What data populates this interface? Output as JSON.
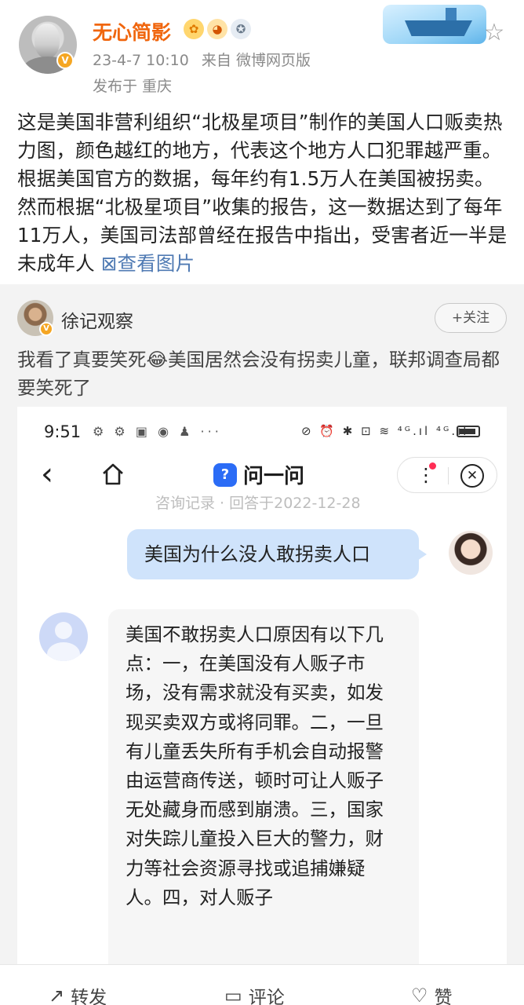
{
  "post": {
    "author": "无心简影",
    "time": "23-4-7 10:10",
    "source": "来自 微博网页版",
    "location": "发布于 重庆",
    "text": "这是美国非营利组织“北极星项目”制作的美国人口贩卖热力图，颜色越红的地方，代表这个地方人口犯罪越严重。根据美国官方的数据，每年约有1.5万人在美国被拐卖。然而根据“北极星项目”收集的报告，这一数据达到了每年11万人，美国司法部曾经在报告中指出，受害者近一半是未成年人 ",
    "view_image": "⊠查看图片",
    "verified_badge": "V"
  },
  "retweet": {
    "author": "徐记观察",
    "follow_label": "+关注",
    "text": "我看了真要笑死😂美国居然会没有拐卖儿童，联邦调查局都要笑死了",
    "verified_badge": "V"
  },
  "screenshot": {
    "status_time": "9:51",
    "status_icons_left": "⚙ ⚙ ▣ ◉ ♟ ···",
    "status_icons_right": "⊘ ⏰ ✱ ⊡ ≋ ⁴ᴳ.ıl ⁴ᴳ.ıl",
    "app_name": "问一问",
    "app_logo": "?",
    "record_line": "咨询记录 · 回答于2022-12-28",
    "question": "美国为什么没人敢拐卖人口",
    "answer": "美国不敢拐卖人口原因有以下几点：一，在美国没有人贩子市场，没有需求就没有买卖，如发现买卖双方或将同罪。二，一旦有儿童丢失所有手机会自动报警由运营商传送，顿时可让人贩子无处藏身而感到崩溃。三，国家对失踪儿童投入巨大的警力，财力等社会资源寻找或追捕嫌疑人。四，对人贩子"
  },
  "actions": {
    "repost": "转发",
    "comment": "评论",
    "like": "赞"
  },
  "colors": {
    "username": "#f0660e",
    "link": "#4f7ab3",
    "question_bubble": "#cfe3fb",
    "retweet_bg": "#f3f3f3"
  }
}
